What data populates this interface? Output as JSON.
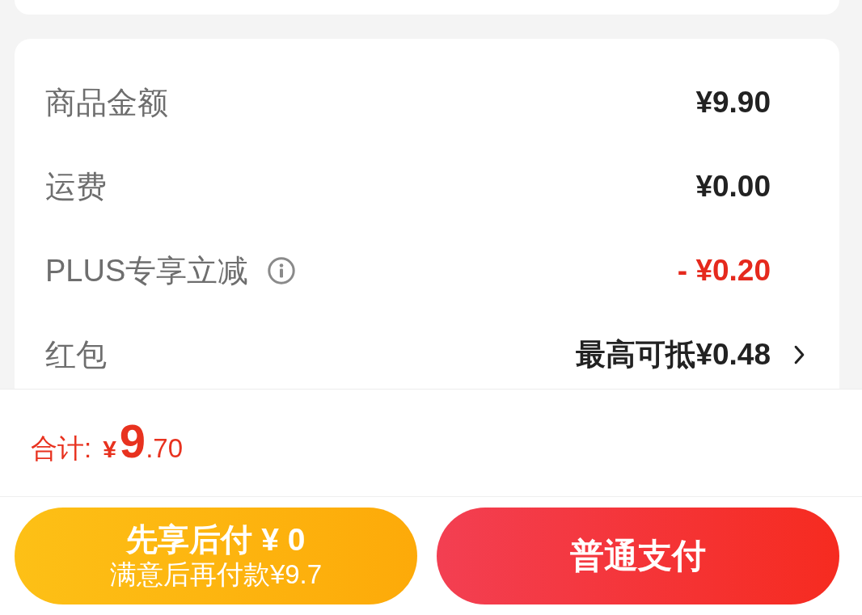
{
  "fee_rows": [
    {
      "label": "商品金额",
      "value": "¥9.90",
      "kind": "amount",
      "info": false
    },
    {
      "label": "运费",
      "value": "¥0.00",
      "kind": "amount",
      "info": false
    },
    {
      "label": "PLUS专享立减",
      "value": "- ¥0.20",
      "kind": "discount",
      "info": true
    },
    {
      "label": "红包",
      "value": "最高可抵¥0.48",
      "kind": "link",
      "info": false
    }
  ],
  "total": {
    "label": "合计:",
    "currency": "¥",
    "integer": "9",
    "decimal": ".70"
  },
  "buttons": [
    {
      "title": "先享后付 ¥ 0",
      "subtitle": "满意后再付款¥9.7",
      "kind": "later"
    },
    {
      "title": "普通支付",
      "kind": "primary"
    }
  ]
}
